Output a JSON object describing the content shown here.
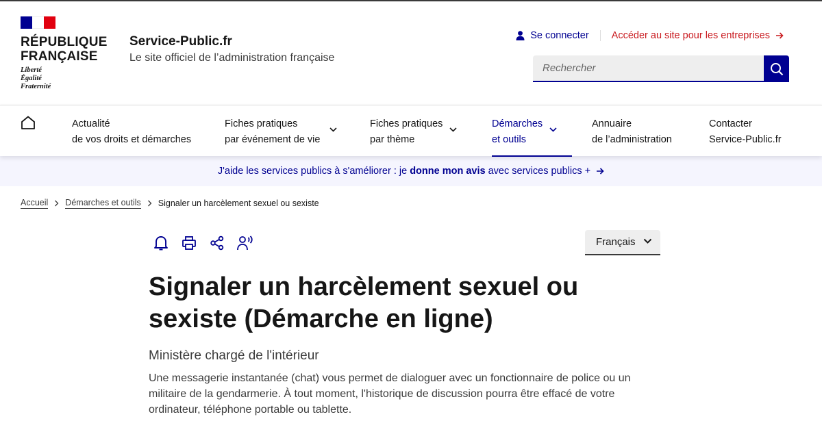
{
  "logo": {
    "republique": "RÉPUBLIQUE",
    "francaise": "FRANÇAISE",
    "motto_1": "Liberté",
    "motto_2": "Égalité",
    "motto_3": "Fraternité"
  },
  "site": {
    "name": "Service-Public.fr",
    "tagline": "Le site officiel de l’administration française"
  },
  "tools": {
    "login": "Se connecter",
    "pro": "Accéder au site pour les entreprises"
  },
  "search": {
    "placeholder": "Rechercher"
  },
  "nav": {
    "items": [
      {
        "line1": "Actualité",
        "line2": "de vos droits et démarches"
      },
      {
        "line1": "Fiches pratiques",
        "line2": "par événement de vie"
      },
      {
        "line1": "Fiches pratiques",
        "line2": "par thème"
      },
      {
        "line1": "Démarches",
        "line2": "et outils"
      },
      {
        "line1": "Annuaire",
        "line2": "de l’administration"
      },
      {
        "line1": "Contacter",
        "line2": "Service-Public.fr"
      }
    ]
  },
  "banner": {
    "prefix": "J'aide les services publics à s'améliorer : je ",
    "bold": "donne mon avis",
    "suffix": " avec services publics +"
  },
  "breadcrumb": {
    "home": "Accueil",
    "parent": "Démarches et outils",
    "current": "Signaler un harcèlement sexuel ou sexiste"
  },
  "language": {
    "selected": "Français"
  },
  "content": {
    "title": "Signaler un harcèlement sexuel ou sexiste (Démarche en ligne)",
    "ministry": "Ministère chargé de l'intérieur",
    "description": "Une messagerie instantanée (chat) vous permet de dialoguer avec un fonctionnaire de police ou un militaire de la gendarmerie. À tout moment, l'historique de discussion pourra être effacé de votre ordinateur, téléphone portable ou tablette."
  },
  "colors": {
    "primary_blue": "#000091",
    "accent_red": "#c9191e",
    "banner_bg": "#f5f5fe",
    "field_bg": "#eeeeee"
  },
  "icons": [
    "user-icon",
    "arrow-right-icon",
    "search-icon",
    "home-icon",
    "chevron-down-icon",
    "chevron-right-icon",
    "bell-icon",
    "printer-icon",
    "share-icon",
    "audio-reading-icon"
  ]
}
